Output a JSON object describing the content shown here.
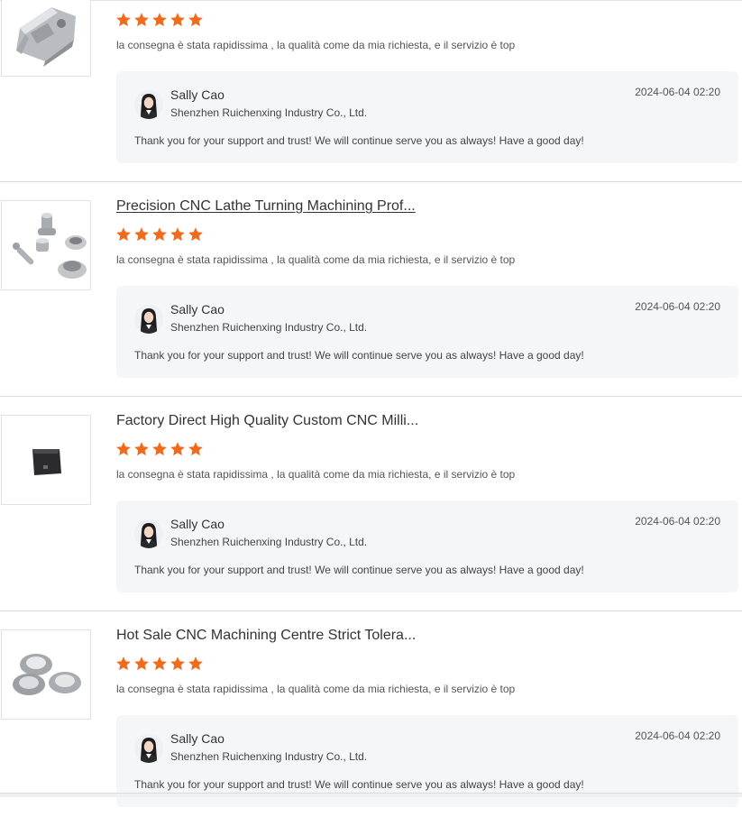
{
  "colors": {
    "star": "#f26b1d",
    "reply_bg": "#f5f6f8",
    "divider": "#dcdcdc"
  },
  "reviews": [
    {
      "title": "",
      "rating": 5,
      "text": "la consegna è stata rapidissima , la qualità come da mia richiesta, e il servizio è top",
      "thumbnail_icon": "bracket-part-icon",
      "reply": {
        "name": "Sally Cao",
        "company": "Shenzhen Ruichenxing Industry Co., Ltd.",
        "date": "2024-06-04 02:20",
        "text": "Thank you for your support and trust!  We will continue serve you as always! Have a good day!"
      }
    },
    {
      "title": "Precision CNC Lathe Turning Machining Prof...",
      "rating": 5,
      "text": "la consegna è stata rapidissima , la qualità come da mia richiesta, e il servizio è top",
      "thumbnail_icon": "turned-parts-icon",
      "reply": {
        "name": "Sally Cao",
        "company": "Shenzhen Ruichenxing Industry Co., Ltd.",
        "date": "2024-06-04 02:20",
        "text": "Thank you for your support and trust!  We will continue serve you as always! Have a good day!"
      }
    },
    {
      "title": "Factory Direct High Quality Custom CNC Milli...",
      "rating": 5,
      "text": "la consegna è stata rapidissima , la qualità come da mia richiesta, e il servizio è top",
      "thumbnail_icon": "milled-block-icon",
      "reply": {
        "name": "Sally Cao",
        "company": "Shenzhen Ruichenxing Industry Co., Ltd.",
        "date": "2024-06-04 02:20",
        "text": "Thank you for your support and trust!  We will continue serve you as always! Have a good day!"
      }
    },
    {
      "title": "Hot Sale CNC Machining Centre Strict Tolera...",
      "rating": 5,
      "text": "la consegna è stata rapidissima , la qualità come da mia richiesta, e il servizio è top",
      "thumbnail_icon": "threaded-rings-icon",
      "reply": {
        "name": "Sally Cao",
        "company": "Shenzhen Ruichenxing Industry Co., Ltd.",
        "date": "2024-06-04 02:20",
        "text": "Thank you for your support and trust!  We will continue serve you as always! Have a good day!"
      }
    }
  ]
}
